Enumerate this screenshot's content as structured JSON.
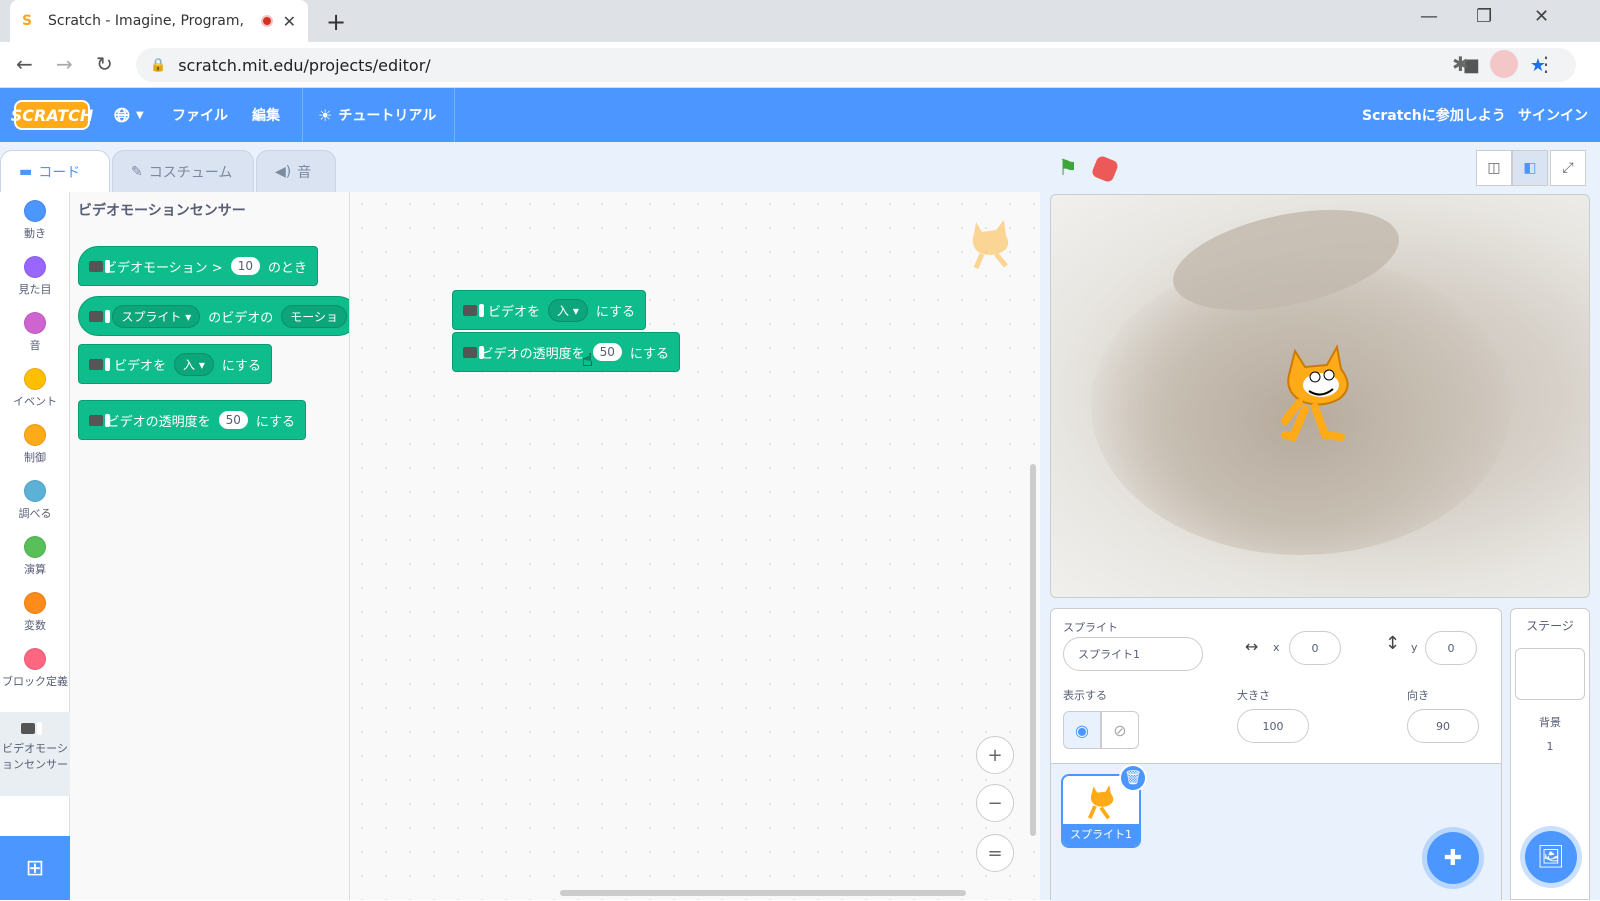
{
  "browser": {
    "tab_title": "Scratch - Imagine, Program, ",
    "url": "scratch.mit.edu/projects/editor/"
  },
  "menubar": {
    "logo": "SCRATCH",
    "file": "ファイル",
    "edit": "編集",
    "tutorials": "チュートリアル",
    "join": "Scratchに参加しよう",
    "signin": "サインイン"
  },
  "editor_tabs": [
    "コード",
    "コスチューム",
    "音"
  ],
  "categories": [
    {
      "label": "動き",
      "color": "#4c97ff"
    },
    {
      "label": "見た目",
      "color": "#9966ff"
    },
    {
      "label": "音",
      "color": "#cf63cf"
    },
    {
      "label": "イベント",
      "color": "#ffbf00"
    },
    {
      "label": "制御",
      "color": "#ffab19"
    },
    {
      "label": "調べる",
      "color": "#5cb1d6"
    },
    {
      "label": "演算",
      "color": "#59c059"
    },
    {
      "label": "変数",
      "color": "#ff8c1a"
    },
    {
      "label": "ブロック定義",
      "color": "#ff6680"
    },
    {
      "label": "ビデオモーションセンサー",
      "color": "#0fbd8c"
    }
  ],
  "palette": {
    "title": "ビデオモーションセンサー",
    "b1": {
      "text": "ビデオモーション >",
      "value": "10",
      "suffix": "のとき"
    },
    "b2": {
      "dropdown": "スプライト",
      "text": "のビデオの",
      "dropdown2": "モーショ"
    },
    "b3": {
      "text": "ビデオを",
      "dropdown": "入",
      "suffix": "にする"
    },
    "b4": {
      "text": "ビデオの透明度を",
      "value": "50",
      "suffix": "にする"
    }
  },
  "script": {
    "s1": {
      "text": "ビデオを",
      "dropdown": "入",
      "suffix": "にする"
    },
    "s2": {
      "text": "ビデオの透明度を",
      "value": "50",
      "suffix": "にする"
    }
  },
  "zoom": {
    "in": "+",
    "out": "−",
    "reset": "="
  },
  "sprite_info": {
    "label": "スプライト",
    "name": "スプライト1",
    "x_label": "x",
    "x": "0",
    "y_label": "y",
    "y": "0",
    "show_label": "表示する",
    "size_label": "大きさ",
    "size": "100",
    "direction_label": "向き",
    "direction": "90"
  },
  "sprites": [
    {
      "name": "スプライト1"
    }
  ],
  "stage_pane": {
    "title": "ステージ",
    "backdrops_label": "背景",
    "backdrops_count": "1"
  }
}
